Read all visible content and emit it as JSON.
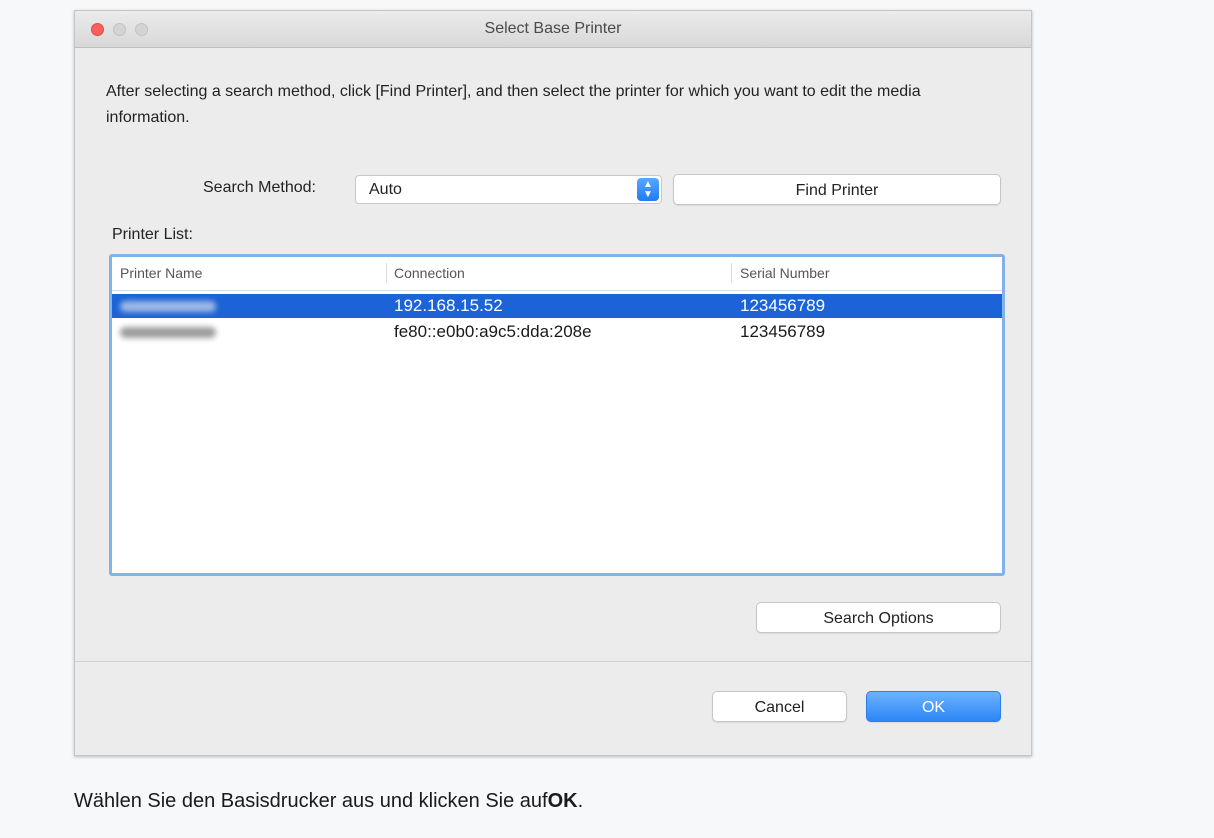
{
  "window": {
    "title": "Select Base Printer"
  },
  "instructions": "After selecting a search method, click [Find Printer], and then select the printer for which you want to edit the media information.",
  "search": {
    "label": "Search Method:",
    "selected": "Auto",
    "find_button": "Find Printer"
  },
  "printer_list": {
    "label": "Printer List:",
    "columns": [
      "Printer Name",
      "Connection",
      "Serial Number"
    ],
    "rows": [
      {
        "name": "",
        "connection": "192.168.15.52",
        "serial": "123456789",
        "selected": true
      },
      {
        "name": "",
        "connection": "fe80::e0b0:a9c5:dda:208e",
        "serial": "123456789",
        "selected": false
      }
    ]
  },
  "buttons": {
    "search_options": "Search Options",
    "cancel": "Cancel",
    "ok": "OK"
  },
  "caption": {
    "text": "Wählen Sie den Basisdrucker aus und klicken Sie auf",
    "bold": "OK",
    "suffix": "."
  },
  "colors": {
    "selection": "#1b63d6",
    "accent": "#2d86f5",
    "close": "#fc605c"
  }
}
